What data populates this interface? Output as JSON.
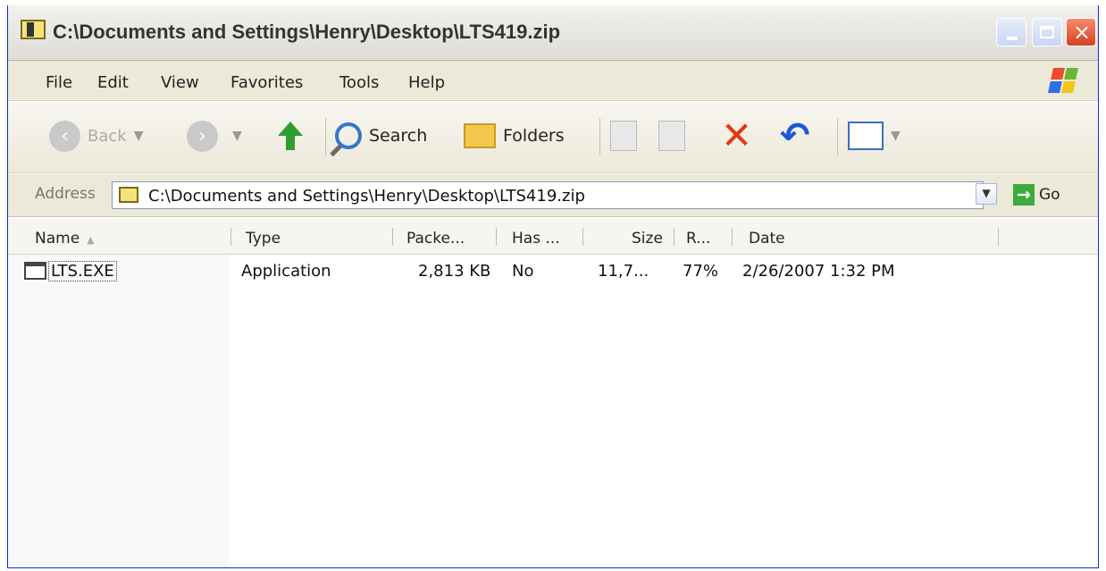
{
  "window": {
    "title": "C:\\Documents and Settings\\Henry\\Desktop\\LTS419.zip"
  },
  "menu": {
    "items": [
      "File",
      "Edit",
      "View",
      "Favorites",
      "Tools",
      "Help"
    ]
  },
  "toolbar": {
    "back_label": "Back",
    "search_label": "Search",
    "folders_label": "Folders"
  },
  "address": {
    "label": "Address",
    "value": "C:\\Documents and Settings\\Henry\\Desktop\\LTS419.zip",
    "go_label": "Go"
  },
  "list": {
    "headers": {
      "name": "Name",
      "type": "Type",
      "packed": "Packe...",
      "has": "Has ...",
      "size": "Size",
      "ratio": "R...",
      "date": "Date"
    },
    "rows": [
      {
        "name": "LTS.EXE",
        "type": "Application",
        "packed": "2,813 KB",
        "has": "No",
        "size": "11,7...",
        "ratio": "77%",
        "date": "2/26/2007 1:32 PM"
      }
    ]
  },
  "colors": {
    "accent": "#0831d9",
    "close_button": "#d7421f",
    "go_green": "#3caa3c",
    "delete_red": "#e23a12"
  },
  "icons": {
    "title": "zip-folder-icon",
    "windows_logo": "windows-logo",
    "file": "application-exe-icon"
  }
}
